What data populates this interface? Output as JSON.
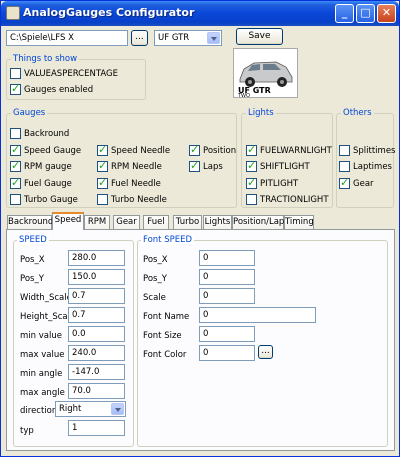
{
  "window": {
    "title": "AnalogGauges Configurator",
    "buttons": {
      "minimize": "_",
      "maximize": "□",
      "close": "✕"
    }
  },
  "toolbar": {
    "path_value": "C:\\Spiele\\LFS X",
    "browse_label": "...",
    "car_select": "UF GTR",
    "save_label": "Save"
  },
  "car_image": {
    "caption": "UF GTR",
    "subcaption": "TWO"
  },
  "things_to_show": {
    "title": "Things to show",
    "items": [
      {
        "label": "VALUEASPERCENTAGE",
        "checked": false
      },
      {
        "label": "Gauges enabled",
        "checked": true
      }
    ]
  },
  "gauges": {
    "title": "Gauges",
    "items": [
      {
        "label": "Backround",
        "checked": false
      },
      {
        "label": "Speed Gauge",
        "checked": true
      },
      {
        "label": "RPM gauge",
        "checked": true
      },
      {
        "label": "Fuel Gauge",
        "checked": true
      },
      {
        "label": "Turbo Gauge",
        "checked": false
      },
      {
        "label": "Speed Needle",
        "checked": true
      },
      {
        "label": "RPM Needle",
        "checked": true
      },
      {
        "label": "Fuel Needle",
        "checked": true
      },
      {
        "label": "Turbo Needle",
        "checked": false
      },
      {
        "label": "Position",
        "checked": true
      },
      {
        "label": "Laps",
        "checked": true
      }
    ]
  },
  "lights": {
    "title": "Lights",
    "items": [
      {
        "label": "FUELWARNLIGHT",
        "checked": true
      },
      {
        "label": "SHIFTLIGHT",
        "checked": true
      },
      {
        "label": "PITLIGHT",
        "checked": true
      },
      {
        "label": "TRACTIONLIGHT",
        "checked": false
      }
    ]
  },
  "others": {
    "title": "Others",
    "items": [
      {
        "label": "Splittimes",
        "checked": false
      },
      {
        "label": "Laptimes",
        "checked": false
      },
      {
        "label": "Gear",
        "checked": true
      }
    ]
  },
  "tabs": [
    "Backround",
    "Speed",
    "RPM",
    "Gear",
    "Fuel",
    "Turbo",
    "Lights",
    "Position/Lap",
    "Timing"
  ],
  "active_tab": "Speed",
  "speed_group": {
    "title": "SPEED",
    "fields": [
      {
        "label": "Pos_X",
        "value": "280.0"
      },
      {
        "label": "Pos_Y",
        "value": "150.0"
      },
      {
        "label": "Width_Scale",
        "value": "0.7"
      },
      {
        "label": "Height_Scale",
        "value": "0.7"
      },
      {
        "label": "min value",
        "value": "0.0"
      },
      {
        "label": "max value",
        "value": "240.0"
      },
      {
        "label": "min angle",
        "value": "-147.0"
      },
      {
        "label": "max angle",
        "value": "70.0"
      }
    ],
    "direction_label": "direction",
    "direction_value": "Right",
    "typ_label": "typ",
    "typ_value": "1"
  },
  "font_group": {
    "title": "Font SPEED",
    "fields": [
      {
        "label": "Pos_X",
        "value": "0"
      },
      {
        "label": "Pos_Y",
        "value": "0"
      },
      {
        "label": "Scale",
        "value": "0"
      },
      {
        "label": "Font Name",
        "value": "0"
      },
      {
        "label": "Font Size",
        "value": "0"
      },
      {
        "label": "Font Color",
        "value": "0"
      }
    ],
    "color_button_label": "..."
  }
}
